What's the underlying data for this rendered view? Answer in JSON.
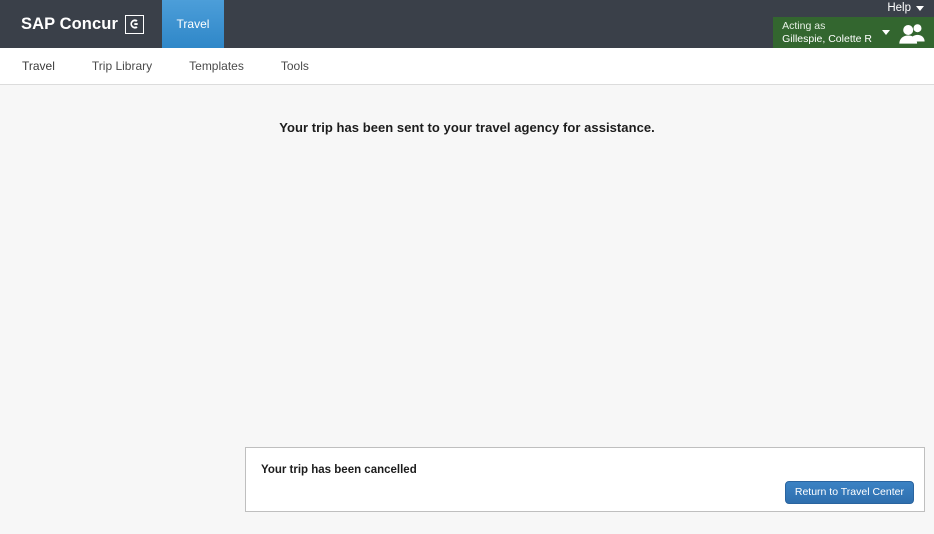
{
  "header": {
    "brand_name": "SAP Concur",
    "brand_mark_icon": "concur-c-logo-icon",
    "product_tab_label": "Travel",
    "help_label": "Help",
    "help_caret_icon": "chevron-down-icon",
    "acting_as_label": "Acting as",
    "acting_as_name": "Gillespie, Colette R",
    "acting_as_caret_icon": "chevron-down-icon",
    "users_icon": "users-icon",
    "colors": {
      "header_bg": "#3a4049",
      "product_tab_bg": "#3d90d0",
      "acting_as_bg": "#33662f"
    }
  },
  "nav": {
    "items": [
      {
        "label": "Travel",
        "active": true
      },
      {
        "label": "Trip Library",
        "active": false
      },
      {
        "label": "Templates",
        "active": false
      },
      {
        "label": "Tools",
        "active": false
      }
    ],
    "active_indicator_icon": "caret-up-icon"
  },
  "main": {
    "message": "Your trip has been sent to your travel agency for assistance."
  },
  "panel": {
    "status_text": "Your trip has been cancelled",
    "button_label": "Return to Travel Center",
    "button_color": "#3b82c4"
  }
}
